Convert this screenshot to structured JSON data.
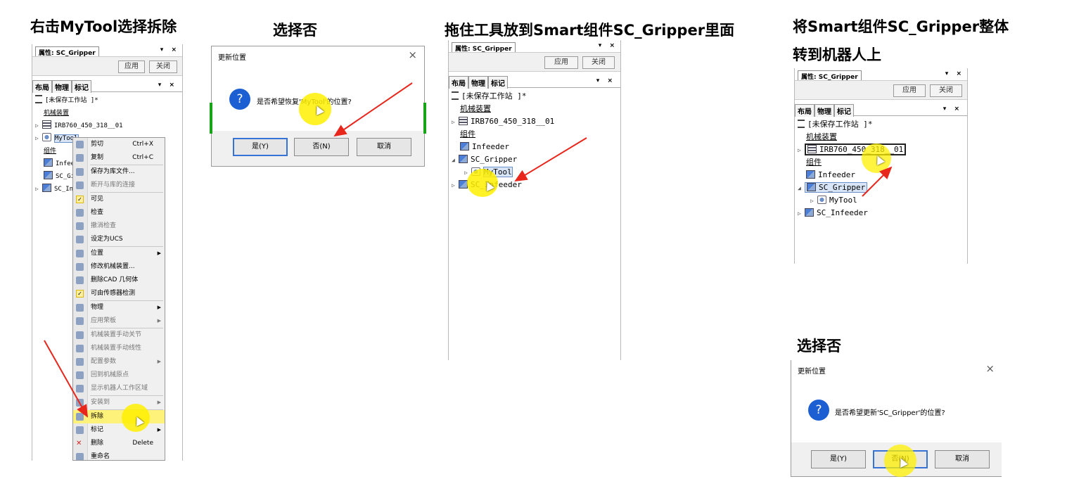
{
  "captions": [
    "右击MyTool选择拆除",
    "选择否",
    "拖住工具放到Smart组件SC_Gripper里面",
    "将Smart组件SC_Gripper整体",
    "转到机器人上",
    "选择否"
  ],
  "panel1": {
    "title": "属性: SC_Gripper",
    "controls": "▾ ×",
    "apply": "应用",
    "close": "关闭",
    "tabs": [
      "布局",
      "物理",
      "标记"
    ],
    "tree": [
      "[未保存工作站 ]*",
      "机械装置",
      "IRB760_450_318__01",
      "MyTool",
      "组件",
      "Infee",
      "SC_Gi",
      "SC_In"
    ]
  },
  "context_menu": [
    {
      "label": "剪切",
      "shortcut": "Ctrl+X"
    },
    {
      "label": "复制",
      "shortcut": "Ctrl+C"
    },
    {
      "label": "保存为库文件..."
    },
    {
      "label": "断开与库的连接"
    },
    {
      "label": "可见"
    },
    {
      "label": "检查"
    },
    {
      "label": "撤消检查"
    },
    {
      "label": "设定为UCS"
    },
    {
      "label": "位置"
    },
    {
      "label": "修改机械装置..."
    },
    {
      "label": "删除CAD 几何体"
    },
    {
      "label": "可由传感器检测"
    },
    {
      "label": "物理"
    },
    {
      "label": "应用荣板"
    },
    {
      "label": "机械装置手动关节"
    },
    {
      "label": "机械装置手动线性"
    },
    {
      "label": "配置参数"
    },
    {
      "label": "回到机械原点"
    },
    {
      "label": "显示机器人工作区域"
    },
    {
      "label": "安装到"
    },
    {
      "label": "拆除"
    },
    {
      "label": "标记"
    },
    {
      "label": "删除",
      "shortcut": "Delete"
    },
    {
      "label": "重命名"
    }
  ],
  "dialog1": {
    "title": "更新位置",
    "message": "是否希望恢复'MyTool'的位置?",
    "yes": "是(Y)",
    "no": "否(N)",
    "cancel": "取消",
    "close_glyph": "×"
  },
  "panel2": {
    "title": "属性: SC_Gripper",
    "controls": "▾ ×",
    "apply": "应用",
    "close": "关闭",
    "tabs": [
      "布局",
      "物理",
      "标记"
    ],
    "tree": [
      "[未保存工作站 ]*",
      "机械装置",
      "IRB760_450_318__01",
      "组件",
      "Infeeder",
      "SC_Gripper",
      "MyTool",
      "SC_Infeeder"
    ]
  },
  "panel3": {
    "title": "属性: SC_Gripper",
    "controls": "▾ ×",
    "apply": "应用",
    "close": "关闭",
    "tabs": [
      "布局",
      "物理",
      "标记"
    ],
    "tree": [
      "[未保存工作站 ]*",
      "机械装置",
      "IRB760_450_318__01",
      "组件",
      "Infeeder",
      "SC_Gripper",
      "MyTool",
      "SC_Infeeder"
    ]
  },
  "dialog2": {
    "title": "更新位置",
    "message": "是否希望更新'SC_Gripper'的位置?",
    "yes": "是(Y)",
    "no": "否(N)",
    "cancel": "取消",
    "close_glyph": "×"
  },
  "colors": {
    "highlight": "#fff000",
    "arrow": "#e8261c",
    "question": "#1c5fd2"
  }
}
